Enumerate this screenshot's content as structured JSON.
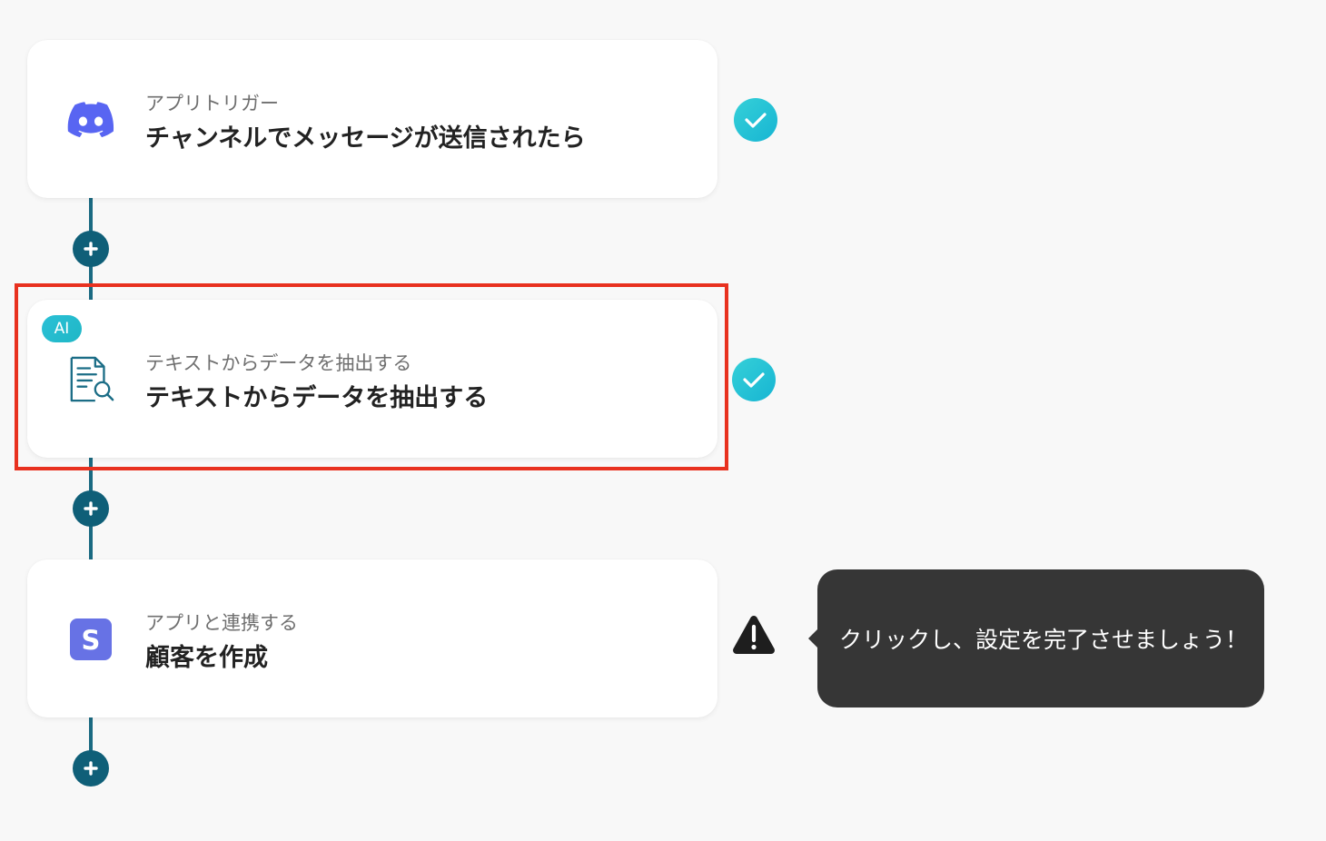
{
  "steps": [
    {
      "subtitle": "アプリトリガー",
      "title": "チャンネルでメッセージが送信されたら",
      "icon": "discord-icon",
      "status": "complete"
    },
    {
      "badge": "AI",
      "subtitle": "テキストからデータを抽出する",
      "title": "テキストからデータを抽出する",
      "icon": "document-search-icon",
      "status": "complete"
    },
    {
      "subtitle": "アプリと連携する",
      "title": "顧客を作成",
      "icon": "stripe-icon",
      "icon_letter": "S",
      "status": "warning"
    }
  ],
  "tooltip": {
    "text": "クリックし、設定を完了させましょう！"
  },
  "colors": {
    "connector": "#1a6a82",
    "plus_button": "#0f5f78",
    "check": "#1fbfd6",
    "highlight": "#e8311f",
    "discord": "#5865f2",
    "stripe": "#6772e5",
    "tooltip_bg": "#363636"
  }
}
